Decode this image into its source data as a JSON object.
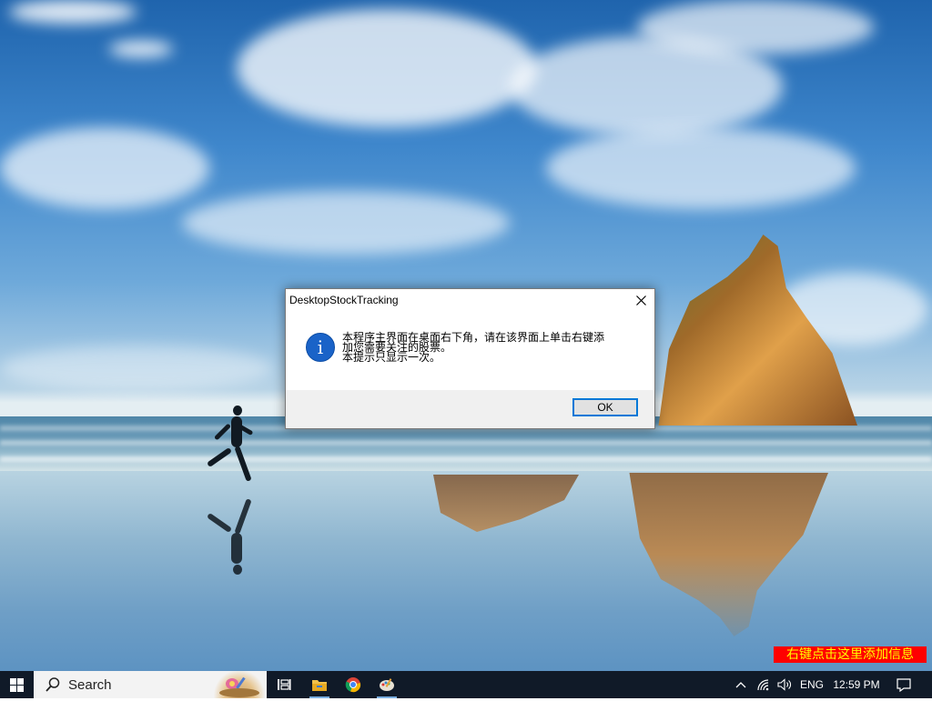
{
  "dialog": {
    "title": "DesktopStockTracking",
    "message_lines": [
      "本程序主界面在桌面右下角，请在该界面上单击右键添",
      "加您需要关注的股票。",
      "本提示只显示一次。"
    ],
    "ok_label": "OK",
    "icon": "info-icon"
  },
  "notice": {
    "text": "右键点击这里添加信息"
  },
  "taskbar": {
    "search_label": "Search",
    "language": "ENG",
    "time": "12:59 PM",
    "icons": [
      "windows-start-icon",
      "search-icon",
      "task-view-icon",
      "file-explorer-icon",
      "chrome-icon",
      "paint-app-icon",
      "chevron-up-icon",
      "network-icon",
      "volume-icon",
      "notification-icon"
    ]
  },
  "colors": {
    "notice_bg": "#ff0000",
    "notice_text": "#ffff00",
    "taskbar_bg": "#101a28",
    "accent": "#0078d7"
  }
}
